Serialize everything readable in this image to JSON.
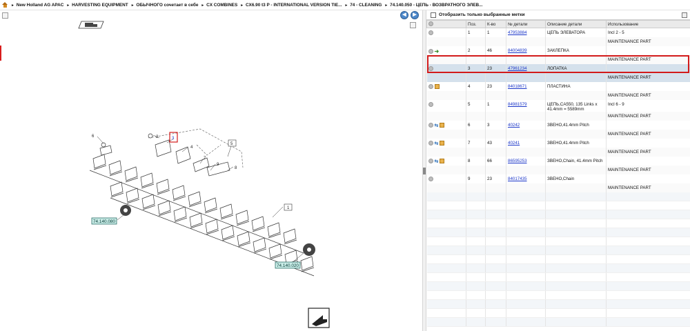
{
  "breadcrumb": [
    {
      "label": "New Holland AG APAC"
    },
    {
      "label": "HARVESTING EQUIPMENT"
    },
    {
      "label": "ОБЫЧНОГО сочетает в себе"
    },
    {
      "label": "CX COMBINES"
    },
    {
      "label": "CX6.90 t3 P - INTERNATIONAL VERSION TIE..."
    },
    {
      "label": "74 - CLEANING"
    },
    {
      "label": "74.140.050 - ЦЕПЬ - ВОЗВРАТНОГО ЭЛЕВ..."
    }
  ],
  "nav": {
    "prev_icon": "◀",
    "next_icon": "▶"
  },
  "filter": {
    "label": "Отобразить только выбранные метки"
  },
  "table": {
    "headers": {
      "pos": "Поз.",
      "qty": "К-во",
      "part": "№ детали",
      "desc": "Описание детали",
      "usage": "Использование"
    },
    "rows": [
      {
        "pos": "1",
        "qty": "1",
        "part": "47953884",
        "desc": "ЦЕПЬ ЭЛЕВАТОРА",
        "usage": "Incl 2 - 5",
        "sub": "MAINTENANCE PART",
        "icons": ""
      },
      {
        "pos": "2",
        "qty": "46",
        "part": "84004839",
        "desc": "ЗАКЛЕПКА",
        "usage": "",
        "sub": "MAINTENANCE PART",
        "icons": "arrow"
      },
      {
        "pos": "3",
        "qty": "23",
        "part": "47961234",
        "desc": "ЛОПАТКА",
        "usage": "",
        "sub": "MAINTENANCE PART",
        "icons": "",
        "selected": true
      },
      {
        "pos": "4",
        "qty": "23",
        "part": "84018671",
        "desc": "ПЛАСТИНА",
        "usage": "",
        "sub": "MAINTENANCE PART",
        "icons": "box"
      },
      {
        "pos": "5",
        "qty": "1",
        "part": "84981579",
        "desc": "ЦЕПЬ,CA550, 135 Links x",
        "desc2": "41.4mm = 5589mm",
        "usage": "Incl 6 - 9",
        "sub": "MAINTENANCE PART",
        "icons": ""
      },
      {
        "pos": "6",
        "qty": "3",
        "part": "40242",
        "desc": "ЗВЕНО,41.4mm Pitch",
        "usage": "",
        "sub": "MAINTENANCE PART",
        "icons": "swapbox"
      },
      {
        "pos": "7",
        "qty": "43",
        "part": "40241",
        "desc": "ЗВЕНО,41.4mm Pitch",
        "usage": "",
        "sub": "MAINTENANCE PART",
        "icons": "swapbox"
      },
      {
        "pos": "8",
        "qty": "66",
        "part": "86595253",
        "desc": "ЗВЕНО,Chain, 41.4mm Pitch",
        "usage": "",
        "sub": "MAINTENANCE PART",
        "icons": "swapbox"
      },
      {
        "pos": "9",
        "qty": "23",
        "part": "84017435",
        "desc": "ЗВЕНО,Chain",
        "usage": "",
        "sub": "MAINTENANCE PART",
        "icons": ""
      }
    ]
  },
  "diagram": {
    "callouts": [
      "1",
      "2",
      "3",
      "4",
      "5",
      "6",
      "7",
      "8",
      "9"
    ],
    "refs": [
      "74.140.080",
      "74.140.020"
    ]
  }
}
